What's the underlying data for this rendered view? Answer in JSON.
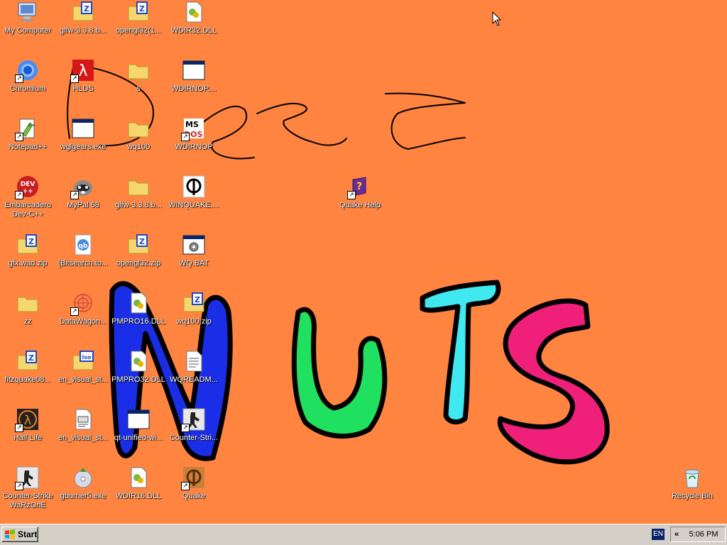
{
  "desktop": {
    "background_color": "#FF8440",
    "icons": [
      {
        "label": "My Computer",
        "icon": "my-computer-icon"
      },
      {
        "label": "glfw-3.3.8.b...",
        "icon": "zip-folder-icon"
      },
      {
        "label": "opengl32(1...",
        "icon": "zip-folder-icon"
      },
      {
        "label": "WDIR32.DLL",
        "icon": "dll-file-icon"
      },
      {
        "label": "Chromium",
        "icon": "chromium-icon"
      },
      {
        "label": "HLDS",
        "icon": "half-life-icon"
      },
      {
        "label": "s",
        "icon": "folder-icon"
      },
      {
        "label": "WDIRNOP....",
        "icon": "window-app-icon"
      },
      {
        "label": "Notepad++",
        "icon": "notepad-plus-plus-icon"
      },
      {
        "label": "wglgears.exe",
        "icon": "window-app-icon"
      },
      {
        "label": "wq100",
        "icon": "folder-icon"
      },
      {
        "label": "WDIRNOP",
        "icon": "ms-dos-icon"
      },
      {
        "label": "Embarcadero Dev-C++",
        "icon": "dev-cpp-icon"
      },
      {
        "label": "MyPal 68",
        "icon": "raccoon-icon"
      },
      {
        "label": "glfw-3.3.8.b...",
        "icon": "folder-icon"
      },
      {
        "label": "WINQUAKE....",
        "icon": "quake-icon"
      },
      {
        "label": "Quake Help",
        "icon": "help-book-icon"
      },
      {
        "label": "gfx.wad.zip",
        "icon": "zip-folder-icon"
      },
      {
        "label": "[Bitsearch.to...",
        "icon": "qbittorrent-icon"
      },
      {
        "label": "opengl32.zip",
        "icon": "zip-folder-icon"
      },
      {
        "label": "WQ.BAT",
        "icon": "batch-file-icon"
      },
      {
        "label": "zz",
        "icon": "folder-icon"
      },
      {
        "label": "DataWagon...",
        "icon": "datawagon-icon"
      },
      {
        "label": "PMPRO16.DLL",
        "icon": "dll-file-icon"
      },
      {
        "label": "wq100.zip",
        "icon": "zip-folder-icon"
      },
      {
        "label": "fitzquake08...",
        "icon": "zip-folder-icon"
      },
      {
        "label": "en_visual_st...",
        "icon": "iso-folder-icon"
      },
      {
        "label": "PMPRO32.DLL",
        "icon": "dll-file-icon"
      },
      {
        "label": "WQREADM...",
        "icon": "text-file-icon"
      },
      {
        "label": "Half Life",
        "icon": "half-life-icon"
      },
      {
        "label": "en_visual_st...",
        "icon": "ini-file-icon"
      },
      {
        "label": "qt-unified-wi...",
        "icon": "window-app-icon"
      },
      {
        "label": "Counter-Stri...",
        "icon": "counter-strike-icon"
      },
      {
        "label": "Counter-Strike WaRzOnE",
        "icon": "counter-strike-icon"
      },
      {
        "label": "gburner5.exe",
        "icon": "gburner-icon"
      },
      {
        "label": "WDIR16.DLL",
        "icon": "dll-file-icon"
      },
      {
        "label": "Quake",
        "icon": "quake-icon"
      },
      {
        "label": "Recycle Bin",
        "icon": "recycle-bin-icon"
      }
    ]
  },
  "taskbar": {
    "start_label": "Start",
    "language": "EN",
    "chevron": "«",
    "clock": "5:06 PM"
  }
}
